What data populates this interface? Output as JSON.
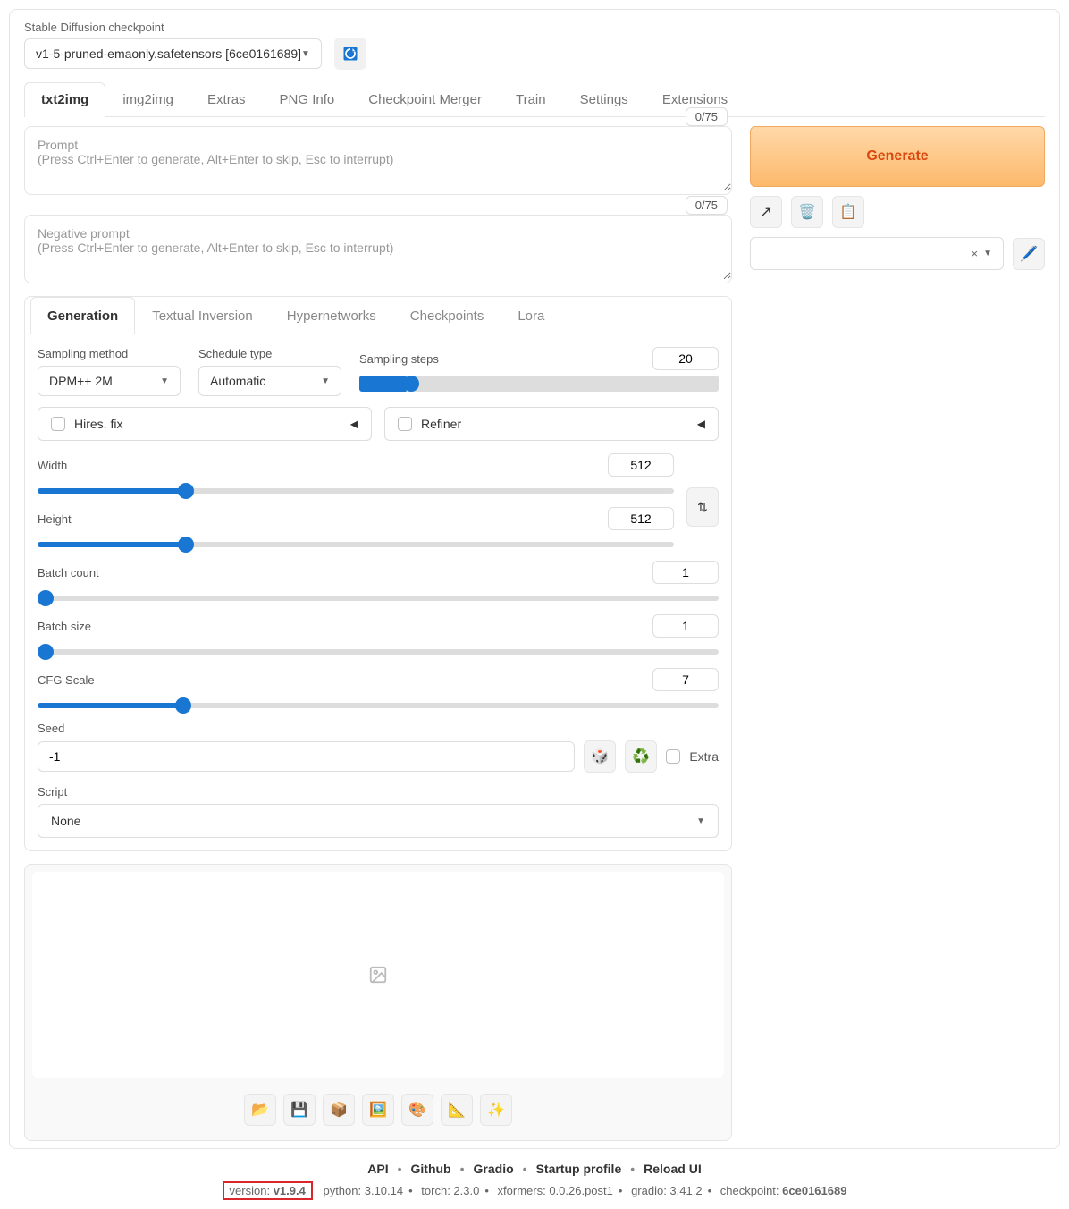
{
  "checkpoint": {
    "label": "Stable Diffusion checkpoint",
    "value": "v1-5-pruned-emaonly.safetensors [6ce0161689]"
  },
  "main_tabs": [
    "txt2img",
    "img2img",
    "Extras",
    "PNG Info",
    "Checkpoint Merger",
    "Train",
    "Settings",
    "Extensions"
  ],
  "main_tab_active": 0,
  "prompt": {
    "placeholder": "Prompt\n(Press Ctrl+Enter to generate, Alt+Enter to skip, Esc to interrupt)",
    "counter": "0/75"
  },
  "neg_prompt": {
    "placeholder": "Negative prompt\n(Press Ctrl+Enter to generate, Alt+Enter to skip, Esc to interrupt)",
    "counter": "0/75"
  },
  "generate_label": "Generate",
  "styles": {
    "clear": "×"
  },
  "sub_tabs": [
    "Generation",
    "Textual Inversion",
    "Hypernetworks",
    "Checkpoints",
    "Lora"
  ],
  "sub_tab_active": 0,
  "sampling": {
    "method_label": "Sampling method",
    "method_value": "DPM++ 2M",
    "schedule_label": "Schedule type",
    "schedule_value": "Automatic",
    "steps_label": "Sampling steps",
    "steps_value": "20"
  },
  "accordions": {
    "hires": "Hires. fix",
    "refiner": "Refiner"
  },
  "dims": {
    "width_label": "Width",
    "width_value": "512",
    "height_label": "Height",
    "height_value": "512"
  },
  "batch": {
    "count_label": "Batch count",
    "count_value": "1",
    "size_label": "Batch size",
    "size_value": "1"
  },
  "cfg": {
    "label": "CFG Scale",
    "value": "7"
  },
  "seed": {
    "label": "Seed",
    "value": "-1",
    "extra_label": "Extra"
  },
  "script": {
    "label": "Script",
    "value": "None"
  },
  "footer": {
    "links": [
      "API",
      "Github",
      "Gradio",
      "Startup profile",
      "Reload UI"
    ],
    "version_label": "version:",
    "version_value": "v1.9.4",
    "meta": {
      "python": "python: 3.10.14",
      "torch": "torch: 2.3.0",
      "xformers": "xformers: 0.0.26.post1",
      "gradio": "gradio: 3.41.2",
      "checkpoint_label": "checkpoint:",
      "checkpoint_value": "6ce0161689"
    }
  }
}
